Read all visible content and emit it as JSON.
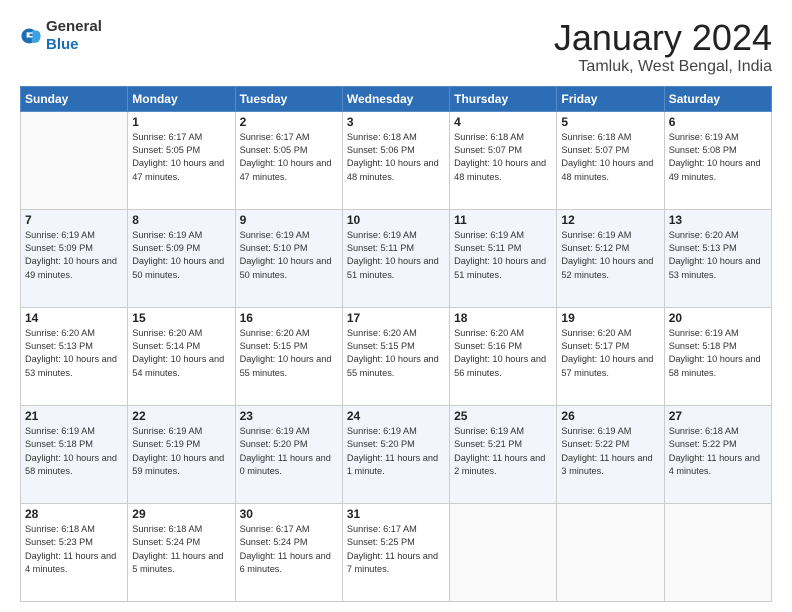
{
  "header": {
    "logo_general": "General",
    "logo_blue": "Blue",
    "month_year": "January 2024",
    "location": "Tamluk, West Bengal, India"
  },
  "days_of_week": [
    "Sunday",
    "Monday",
    "Tuesday",
    "Wednesday",
    "Thursday",
    "Friday",
    "Saturday"
  ],
  "weeks": [
    [
      {
        "day": "",
        "sunrise": "",
        "sunset": "",
        "daylight": "",
        "empty": true
      },
      {
        "day": "1",
        "sunrise": "Sunrise: 6:17 AM",
        "sunset": "Sunset: 5:05 PM",
        "daylight": "Daylight: 10 hours and 47 minutes."
      },
      {
        "day": "2",
        "sunrise": "Sunrise: 6:17 AM",
        "sunset": "Sunset: 5:05 PM",
        "daylight": "Daylight: 10 hours and 47 minutes."
      },
      {
        "day": "3",
        "sunrise": "Sunrise: 6:18 AM",
        "sunset": "Sunset: 5:06 PM",
        "daylight": "Daylight: 10 hours and 48 minutes."
      },
      {
        "day": "4",
        "sunrise": "Sunrise: 6:18 AM",
        "sunset": "Sunset: 5:07 PM",
        "daylight": "Daylight: 10 hours and 48 minutes."
      },
      {
        "day": "5",
        "sunrise": "Sunrise: 6:18 AM",
        "sunset": "Sunset: 5:07 PM",
        "daylight": "Daylight: 10 hours and 48 minutes."
      },
      {
        "day": "6",
        "sunrise": "Sunrise: 6:19 AM",
        "sunset": "Sunset: 5:08 PM",
        "daylight": "Daylight: 10 hours and 49 minutes."
      }
    ],
    [
      {
        "day": "7",
        "sunrise": "Sunrise: 6:19 AM",
        "sunset": "Sunset: 5:09 PM",
        "daylight": "Daylight: 10 hours and 49 minutes."
      },
      {
        "day": "8",
        "sunrise": "Sunrise: 6:19 AM",
        "sunset": "Sunset: 5:09 PM",
        "daylight": "Daylight: 10 hours and 50 minutes."
      },
      {
        "day": "9",
        "sunrise": "Sunrise: 6:19 AM",
        "sunset": "Sunset: 5:10 PM",
        "daylight": "Daylight: 10 hours and 50 minutes."
      },
      {
        "day": "10",
        "sunrise": "Sunrise: 6:19 AM",
        "sunset": "Sunset: 5:11 PM",
        "daylight": "Daylight: 10 hours and 51 minutes."
      },
      {
        "day": "11",
        "sunrise": "Sunrise: 6:19 AM",
        "sunset": "Sunset: 5:11 PM",
        "daylight": "Daylight: 10 hours and 51 minutes."
      },
      {
        "day": "12",
        "sunrise": "Sunrise: 6:19 AM",
        "sunset": "Sunset: 5:12 PM",
        "daylight": "Daylight: 10 hours and 52 minutes."
      },
      {
        "day": "13",
        "sunrise": "Sunrise: 6:20 AM",
        "sunset": "Sunset: 5:13 PM",
        "daylight": "Daylight: 10 hours and 53 minutes."
      }
    ],
    [
      {
        "day": "14",
        "sunrise": "Sunrise: 6:20 AM",
        "sunset": "Sunset: 5:13 PM",
        "daylight": "Daylight: 10 hours and 53 minutes."
      },
      {
        "day": "15",
        "sunrise": "Sunrise: 6:20 AM",
        "sunset": "Sunset: 5:14 PM",
        "daylight": "Daylight: 10 hours and 54 minutes."
      },
      {
        "day": "16",
        "sunrise": "Sunrise: 6:20 AM",
        "sunset": "Sunset: 5:15 PM",
        "daylight": "Daylight: 10 hours and 55 minutes."
      },
      {
        "day": "17",
        "sunrise": "Sunrise: 6:20 AM",
        "sunset": "Sunset: 5:15 PM",
        "daylight": "Daylight: 10 hours and 55 minutes."
      },
      {
        "day": "18",
        "sunrise": "Sunrise: 6:20 AM",
        "sunset": "Sunset: 5:16 PM",
        "daylight": "Daylight: 10 hours and 56 minutes."
      },
      {
        "day": "19",
        "sunrise": "Sunrise: 6:20 AM",
        "sunset": "Sunset: 5:17 PM",
        "daylight": "Daylight: 10 hours and 57 minutes."
      },
      {
        "day": "20",
        "sunrise": "Sunrise: 6:19 AM",
        "sunset": "Sunset: 5:18 PM",
        "daylight": "Daylight: 10 hours and 58 minutes."
      }
    ],
    [
      {
        "day": "21",
        "sunrise": "Sunrise: 6:19 AM",
        "sunset": "Sunset: 5:18 PM",
        "daylight": "Daylight: 10 hours and 58 minutes."
      },
      {
        "day": "22",
        "sunrise": "Sunrise: 6:19 AM",
        "sunset": "Sunset: 5:19 PM",
        "daylight": "Daylight: 10 hours and 59 minutes."
      },
      {
        "day": "23",
        "sunrise": "Sunrise: 6:19 AM",
        "sunset": "Sunset: 5:20 PM",
        "daylight": "Daylight: 11 hours and 0 minutes."
      },
      {
        "day": "24",
        "sunrise": "Sunrise: 6:19 AM",
        "sunset": "Sunset: 5:20 PM",
        "daylight": "Daylight: 11 hours and 1 minute."
      },
      {
        "day": "25",
        "sunrise": "Sunrise: 6:19 AM",
        "sunset": "Sunset: 5:21 PM",
        "daylight": "Daylight: 11 hours and 2 minutes."
      },
      {
        "day": "26",
        "sunrise": "Sunrise: 6:19 AM",
        "sunset": "Sunset: 5:22 PM",
        "daylight": "Daylight: 11 hours and 3 minutes."
      },
      {
        "day": "27",
        "sunrise": "Sunrise: 6:18 AM",
        "sunset": "Sunset: 5:22 PM",
        "daylight": "Daylight: 11 hours and 4 minutes."
      }
    ],
    [
      {
        "day": "28",
        "sunrise": "Sunrise: 6:18 AM",
        "sunset": "Sunset: 5:23 PM",
        "daylight": "Daylight: 11 hours and 4 minutes."
      },
      {
        "day": "29",
        "sunrise": "Sunrise: 6:18 AM",
        "sunset": "Sunset: 5:24 PM",
        "daylight": "Daylight: 11 hours and 5 minutes."
      },
      {
        "day": "30",
        "sunrise": "Sunrise: 6:17 AM",
        "sunset": "Sunset: 5:24 PM",
        "daylight": "Daylight: 11 hours and 6 minutes."
      },
      {
        "day": "31",
        "sunrise": "Sunrise: 6:17 AM",
        "sunset": "Sunset: 5:25 PM",
        "daylight": "Daylight: 11 hours and 7 minutes."
      },
      {
        "day": "",
        "sunrise": "",
        "sunset": "",
        "daylight": "",
        "empty": true
      },
      {
        "day": "",
        "sunrise": "",
        "sunset": "",
        "daylight": "",
        "empty": true
      },
      {
        "day": "",
        "sunrise": "",
        "sunset": "",
        "daylight": "",
        "empty": true
      }
    ]
  ]
}
